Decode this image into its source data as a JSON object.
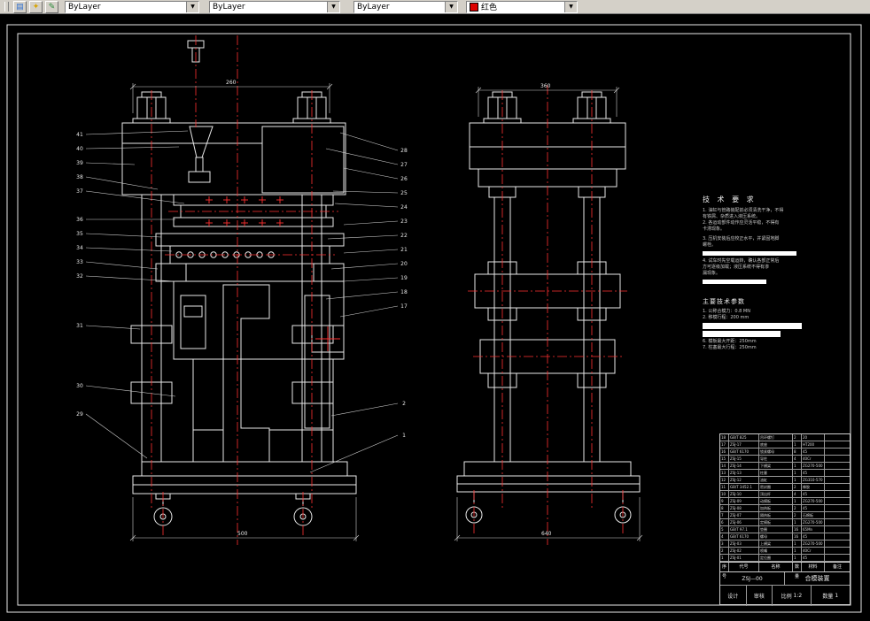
{
  "toolbar": {
    "icons": [
      {
        "name": "layers-dialog",
        "glyph": "▤"
      },
      {
        "name": "layer-states",
        "glyph": "✦"
      },
      {
        "name": "make-object-layer-current",
        "glyph": "✎"
      }
    ],
    "combos": [
      {
        "value": "ByLayer"
      },
      {
        "value": "ByLayer"
      },
      {
        "value": "ByLayer"
      },
      {
        "value": "红色",
        "swatch": "#dd0000"
      }
    ],
    "arrow": "▼"
  },
  "colors": {
    "centerline": "#ff3030",
    "drawing_line": "#e8e8e8",
    "toolbar_bg": "#d4d0c8",
    "color_swatch": "#dd0000"
  },
  "tech_requirements": {
    "title": "技 术 要 求",
    "lines": [
      "1. 油缸与管路装配前必须清洗干净，不得",
      "    有铁屑、杂质进入液压系统。",
      "2. 各运动部件动作应灵活平稳，不得有",
      "    卡滞现象。"
    ],
    "para1": [
      "3. 压机安装后应校正水平，并紧固地脚",
      "    螺栓。"
    ],
    "para2": [
      "4. 试车时先空载运转，确认各部正常后",
      "    方可逐级加载；液压系统不得有渗",
      "    漏现象。"
    ]
  },
  "parameters": {
    "title": "主要技术参数",
    "items_top": [
      "1. 公称合模力：0.8 MN",
      "2. 移模行程：200 mm"
    ],
    "items_bottom": [
      "6. 模板最大开距：250mm",
      "7. 柱塞最大行程：250mm"
    ]
  },
  "dims": {
    "left_top": "260",
    "left_bottom": "500",
    "right_top": "360",
    "right_bottom": "640"
  },
  "callouts": {
    "left": [
      "41",
      "40",
      "39",
      "38",
      "37",
      "36",
      "35",
      "34",
      "33",
      "32",
      "31",
      "30",
      "29"
    ],
    "right": [
      "28",
      "27",
      "26",
      "25",
      "24",
      "23",
      "22",
      "21",
      "20",
      "19",
      "18",
      "17"
    ],
    "extra": [
      "2",
      "1"
    ]
  },
  "bom": {
    "headers": [
      "序号",
      "代号",
      "名称",
      "数量",
      "材料",
      "备注"
    ],
    "rows": [
      {
        "no": "18",
        "code": "GB/T 825",
        "name": "吊环螺钉",
        "qty": "2",
        "mat": "20",
        "note": ""
      },
      {
        "no": "17",
        "code": "ZSJ-17",
        "name": "底座",
        "qty": "1",
        "mat": "HT200",
        "note": ""
      },
      {
        "no": "16",
        "code": "GB/T 6170",
        "name": "锁紧螺母",
        "qty": "8",
        "mat": "45",
        "note": ""
      },
      {
        "no": "15",
        "code": "ZSJ-15",
        "name": "导柱",
        "qty": "4",
        "mat": "40Cr",
        "note": ""
      },
      {
        "no": "14",
        "code": "ZSJ-14",
        "name": "下横梁",
        "qty": "1",
        "mat": "ZG270-500",
        "note": ""
      },
      {
        "no": "13",
        "code": "ZSJ-13",
        "name": "柱塞",
        "qty": "1",
        "mat": "45",
        "note": ""
      },
      {
        "no": "12",
        "code": "ZSJ-12",
        "name": "油缸",
        "qty": "1",
        "mat": "ZG310-570",
        "note": ""
      },
      {
        "no": "11",
        "code": "GB/T 3452.1",
        "name": "密封圈",
        "qty": "2",
        "mat": "橡胶",
        "note": ""
      },
      {
        "no": "10",
        "code": "ZSJ-10",
        "name": "顶出杆",
        "qty": "4",
        "mat": "45",
        "note": ""
      },
      {
        "no": "9",
        "code": "ZSJ-09",
        "name": "动模板",
        "qty": "1",
        "mat": "ZG270-500",
        "note": ""
      },
      {
        "no": "8",
        "code": "ZSJ-08",
        "name": "加热板",
        "qty": "2",
        "mat": "45",
        "note": ""
      },
      {
        "no": "7",
        "code": "ZSJ-07",
        "name": "隔热板",
        "qty": "2",
        "mat": "石棉板",
        "note": ""
      },
      {
        "no": "6",
        "code": "ZSJ-06",
        "name": "定模板",
        "qty": "1",
        "mat": "ZG270-500",
        "note": ""
      },
      {
        "no": "5",
        "code": "GB/T 97.1",
        "name": "垫圈",
        "qty": "16",
        "mat": "65Mn",
        "note": ""
      },
      {
        "no": "4",
        "code": "GB/T 6170",
        "name": "螺母",
        "qty": "16",
        "mat": "45",
        "note": ""
      },
      {
        "no": "3",
        "code": "ZSJ-03",
        "name": "上横梁",
        "qty": "1",
        "mat": "ZG270-500",
        "note": ""
      },
      {
        "no": "2",
        "code": "ZSJ-02",
        "name": "喷嘴",
        "qty": "1",
        "mat": "40Cr",
        "note": ""
      },
      {
        "no": "1",
        "code": "ZSJ-01",
        "name": "定位圈",
        "qty": "1",
        "mat": "45",
        "note": ""
      }
    ]
  },
  "title_block": {
    "code": "ZSJ—00",
    "name": "合模装置",
    "design_label": "设计",
    "check_label": "审核",
    "scale_label": "比例",
    "scale": "1:2",
    "qty_label": "数量",
    "qty": "1"
  }
}
